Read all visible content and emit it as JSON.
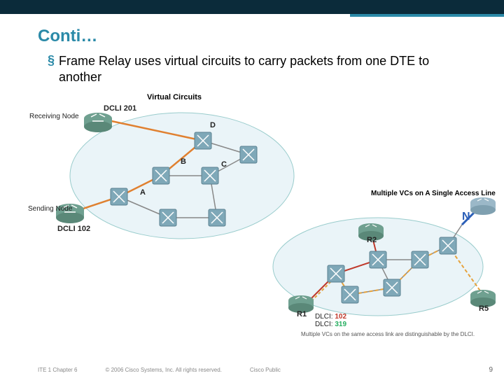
{
  "title": "Conti…",
  "bullet": "Frame Relay uses virtual circuits to carry packets from one DTE to another",
  "diagram1": {
    "caption": "Virtual Circuits",
    "receiving_node": "Receiving Node",
    "sending_node": "Sending Node",
    "dlci_top": "DCLI 201",
    "dlci_bottom": "DCLI 102",
    "labels": {
      "A": "A",
      "B": "B",
      "C": "C",
      "D": "D"
    }
  },
  "diagram2": {
    "caption": "Multiple VCs on A Single Access Line",
    "r1": "R1",
    "r2": "R2",
    "r5": "R5",
    "dlci_label": "DLCI:",
    "dlci1": "102",
    "dlci2": "319",
    "footnote": "Multiple VCs on the same access link are distinguishable by the DLCI."
  },
  "footer": {
    "left": "ITE 1 Chapter 6",
    "copyright": "© 2006 Cisco Systems, Inc. All rights reserved.",
    "classification": "Cisco Public",
    "page": "9"
  }
}
